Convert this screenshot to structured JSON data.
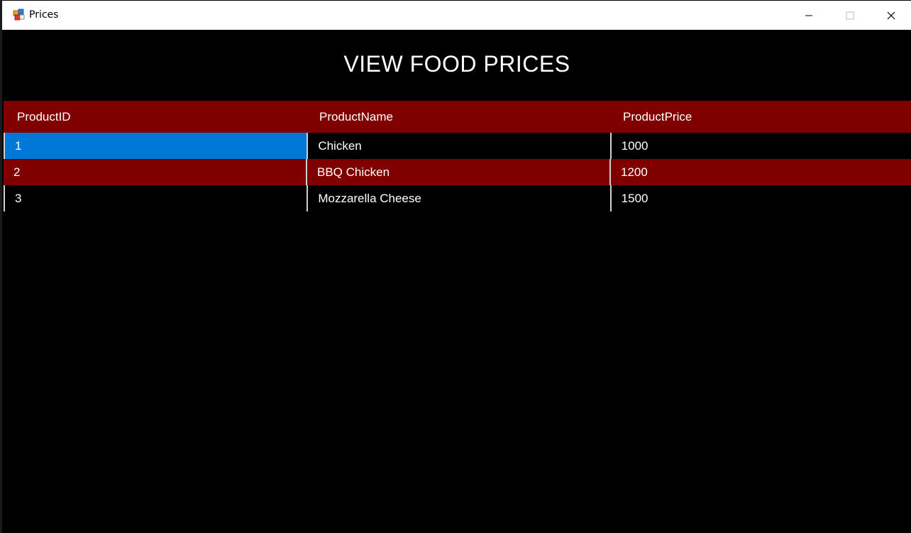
{
  "window": {
    "title": "Prices",
    "controls": {
      "minimize_icon": "minimize-icon",
      "maximize_icon": "maximize-icon",
      "close_icon": "close-icon"
    }
  },
  "heading": "VIEW FOOD PRICES",
  "table": {
    "columns": [
      "ProductID",
      "ProductName",
      "ProductPrice"
    ],
    "rows": [
      {
        "id": "1",
        "name": "Chicken",
        "price": "1000"
      },
      {
        "id": "2",
        "name": "BBQ Chicken",
        "price": "1200"
      },
      {
        "id": "3",
        "name": "Mozzarella Cheese",
        "price": "1500"
      }
    ],
    "selected_row": 0
  },
  "colors": {
    "header_bg": "#800000",
    "alt_row_bg": "#800000",
    "selection": "#0078d7",
    "background": "#000000",
    "text": "#ffffff"
  }
}
